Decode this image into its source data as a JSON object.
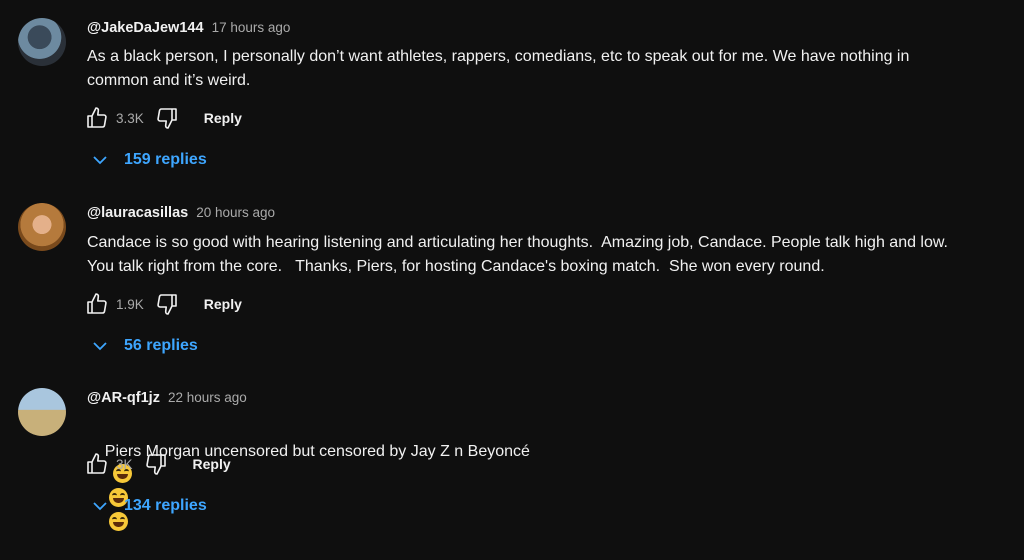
{
  "comments": [
    {
      "author": "@JakeDaJew144",
      "time": "17 hours ago",
      "text": "As a black person, I personally don’t want athletes, rappers, comedians, etc to speak out for me. We have nothing in\ncommon and it’s weird.",
      "likes": "3.3K",
      "reply_label": "Reply",
      "replies_label": "159 replies"
    },
    {
      "author": "@lauracasillas",
      "time": "20 hours ago",
      "text": "Candace is so good with hearing listening and articulating her thoughts.  Amazing job, Candace. People talk high and low.\nYou talk right from the core.   Thanks, Piers, for hosting Candace's boxing match.  She won every round.",
      "likes": "1.9K",
      "reply_label": "Reply",
      "replies_label": "56 replies"
    },
    {
      "author": "@AR-qf1jz",
      "time": "22 hours ago",
      "text": "Piers Morgan uncensored but censored by Jay Z n Beyoncé",
      "emojis": [
        "face-with-tears-of-joy",
        "face-with-tears-of-joy",
        "face-with-tears-of-joy"
      ],
      "likes": "3K",
      "reply_label": "Reply",
      "replies_label": "134 replies"
    }
  ],
  "colors": {
    "background": "#0f0f0f",
    "text": "#f1f1f1",
    "secondary": "#aaaaaa",
    "link": "#3ea6ff"
  }
}
